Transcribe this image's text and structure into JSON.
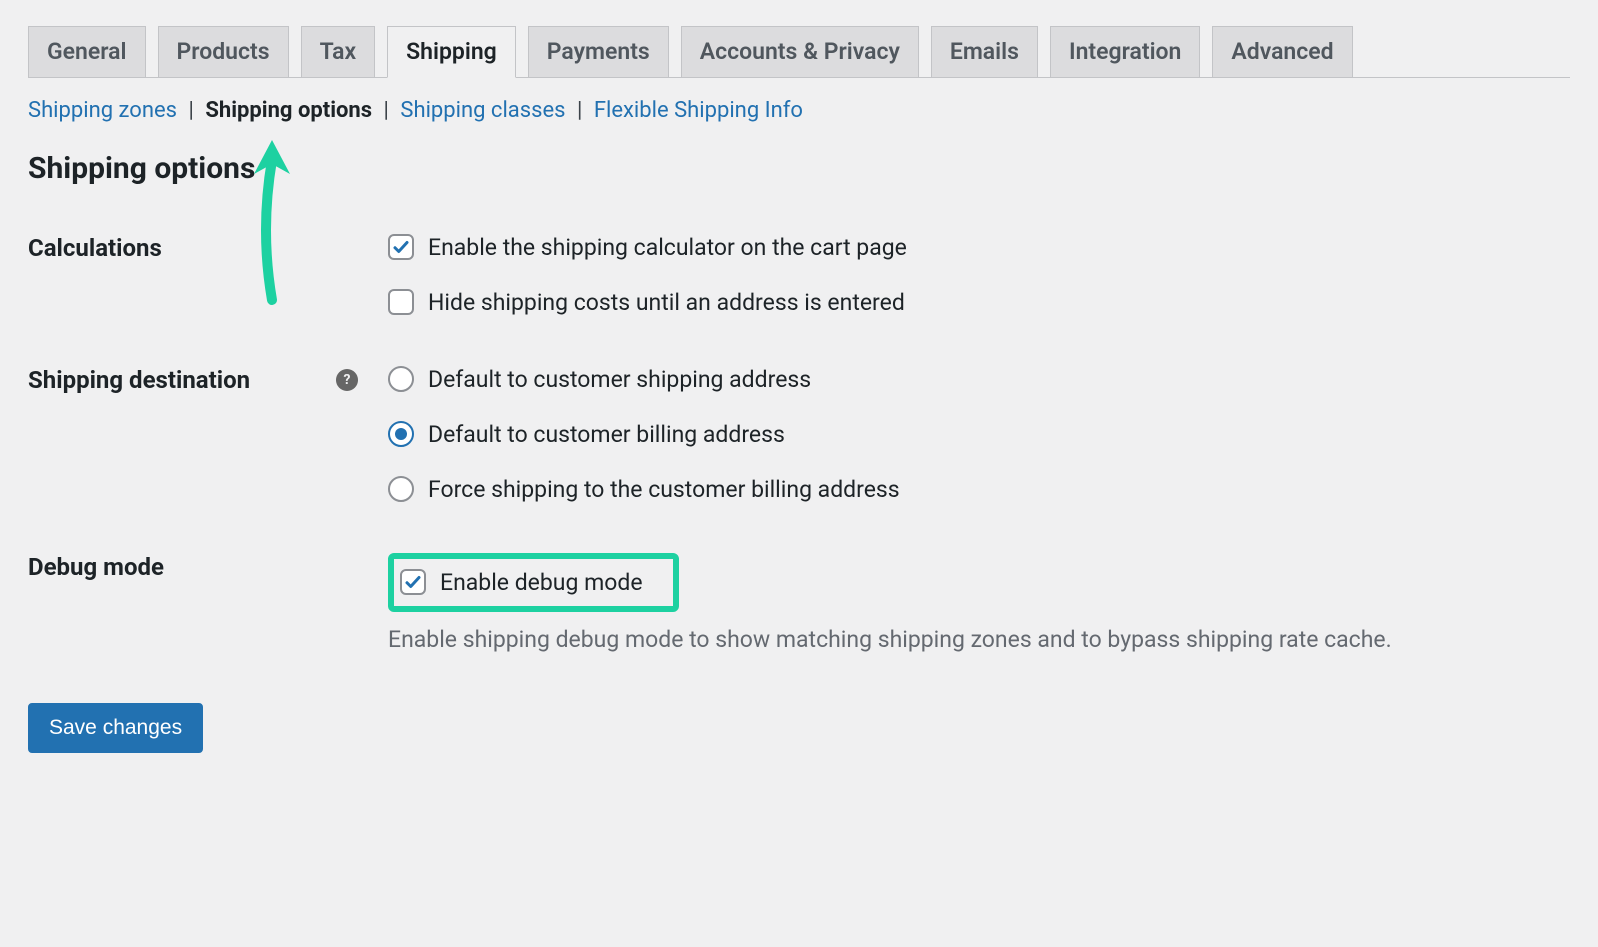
{
  "tabs": {
    "general": "General",
    "products": "Products",
    "tax": "Tax",
    "shipping": "Shipping",
    "payments": "Payments",
    "accounts": "Accounts & Privacy",
    "emails": "Emails",
    "integration": "Integration",
    "advanced": "Advanced"
  },
  "subtabs": {
    "zones": "Shipping zones",
    "options": "Shipping options",
    "classes": "Shipping classes",
    "flex": "Flexible Shipping Info"
  },
  "page_title": "Shipping options",
  "rows": {
    "calculations": {
      "label": "Calculations",
      "opt_enable_calc": "Enable the shipping calculator on the cart page",
      "opt_hide_costs": "Hide shipping costs until an address is entered"
    },
    "destination": {
      "label": "Shipping destination",
      "help": "?",
      "opt_shipping": "Default to customer shipping address",
      "opt_billing": "Default to customer billing address",
      "opt_force": "Force shipping to the customer billing address"
    },
    "debug": {
      "label": "Debug mode",
      "opt_enable": "Enable debug mode",
      "description": "Enable shipping debug mode to show matching shipping zones and to bypass shipping rate cache."
    }
  },
  "save_label": "Save changes"
}
